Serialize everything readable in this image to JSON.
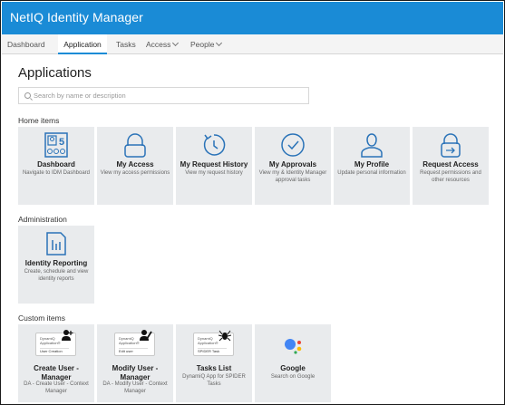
{
  "app": {
    "title": "NetIQ Identity Manager"
  },
  "nav": {
    "dashboard": "Dashboard",
    "application": "Application",
    "tasks": "Tasks",
    "access": "Access",
    "people": "People"
  },
  "page": {
    "title": "Applications"
  },
  "search": {
    "placeholder": "Search by name or description",
    "value": ""
  },
  "sections": {
    "home": "Home items",
    "admin": "Administration",
    "custom": "Custom items"
  },
  "home_items": [
    {
      "title": "Dashboard",
      "desc": "Navigate to IDM Dashboard",
      "icon": "dashboard-icon"
    },
    {
      "title": "My Access",
      "desc": "View my access permissions",
      "icon": "lock-icon"
    },
    {
      "title": "My Request History",
      "desc": "View my request history",
      "icon": "history-icon"
    },
    {
      "title": "My Approvals",
      "desc": "View my & Identity Manager approval tasks",
      "icon": "check-circle-icon"
    },
    {
      "title": "My Profile",
      "desc": "Update personal information",
      "icon": "person-icon"
    },
    {
      "title": "Request Access",
      "desc": "Request permissions and other resources",
      "icon": "request-lock-icon"
    }
  ],
  "admin_items": [
    {
      "title": "Identity Reporting",
      "desc": "Create, schedule and view identity reports",
      "icon": "report-icon"
    }
  ],
  "custom_items": [
    {
      "title": "Create User - Manager",
      "desc": "DA - Create User - Context Manager",
      "card_l1": "DynamiQ Application®",
      "card_l2": "User Creation",
      "icon": "user-add-icon"
    },
    {
      "title": "Modify User - Manager",
      "desc": "DA - Modify User - Context Manager",
      "card_l1": "DynamiQ Application®",
      "card_l2": "Edit user",
      "icon": "user-edit-icon"
    },
    {
      "title": "Tasks List",
      "desc": "DynamiQ App for SPIDER Tasks",
      "card_l1": "DynamiQ Application®",
      "card_l2": "SPIDER Task",
      "icon": "spider-icon"
    },
    {
      "title": "Google",
      "desc": "Search on Google",
      "icon": "google-assistant-icon"
    }
  ],
  "colors": {
    "brand": "#1a8bd6",
    "tile_bg": "#e9ebed",
    "google_blue": "#4285f4",
    "google_red": "#ea4335",
    "google_yellow": "#fbbc05",
    "google_green": "#34a853"
  }
}
